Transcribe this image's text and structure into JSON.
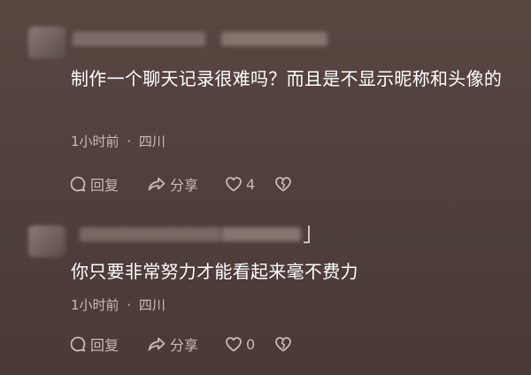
{
  "comments": [
    {
      "text": "制作一个聊天记录很难吗？而且是不显示昵称和头像的",
      "time": "1小时前",
      "separator": "·",
      "location": "四川",
      "reply_label": "回复",
      "share_label": "分享",
      "like_count": "4"
    },
    {
      "text": "你只要非常努力才能看起来毫不费力",
      "time": "1小时前",
      "separator": "·",
      "location": "四川",
      "reply_label": "回复",
      "share_label": "分享",
      "like_count": "0"
    }
  ],
  "icons": {
    "reply": "reply-bubble-icon",
    "share": "share-arrow-icon",
    "like": "heart-icon",
    "dislike": "broken-heart-icon"
  },
  "colors": {
    "background": "#503f3b",
    "text": "#ffffff",
    "secondary": "#c9bbb7"
  }
}
